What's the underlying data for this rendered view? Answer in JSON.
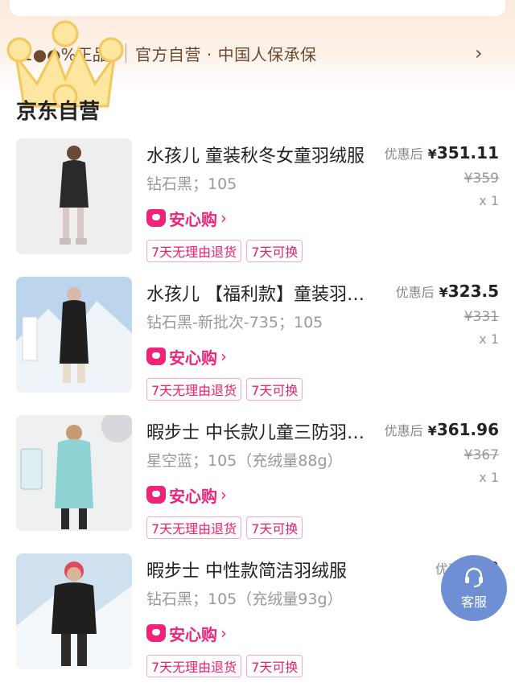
{
  "banner": {
    "badge": "1●●%正品",
    "text": "官方自营 · 中国人保承保",
    "arrow": "›"
  },
  "section_title": "京东自营",
  "products": [
    {
      "title": "水孩儿 童装秋冬女童羽绒服",
      "spec": "钻石黑；105",
      "anxin": "安心购",
      "tags": [
        "7天无理由退货",
        "7天可换"
      ],
      "price_label": "优惠后",
      "price_yen": "¥",
      "price": "351.11",
      "orig_price": "¥359",
      "qty": "x 1"
    },
    {
      "title": "水孩儿 【福利款】童装羽绒服",
      "spec": "钻石黑-新批次-735；105",
      "anxin": "安心购",
      "tags": [
        "7天无理由退货",
        "7天可换"
      ],
      "price_label": "优惠后",
      "price_yen": "¥",
      "price": "323.5",
      "orig_price": "¥331",
      "qty": "x 1"
    },
    {
      "title": "暇步士 中长款儿童三防羽绒服",
      "spec": "星空蓝；105（充绒量88g）",
      "anxin": "安心购",
      "tags": [
        "7天无理由退货",
        "7天可换"
      ],
      "price_label": "优惠后",
      "price_yen": "¥",
      "price": "361.96",
      "orig_price": "¥367",
      "qty": "x 1"
    },
    {
      "title": "暇步士 中性款简洁羽绒服",
      "spec": "钻石黑；105（充绒量93g）",
      "anxin": "安心购",
      "tags": [
        "7天无理由退货",
        "7天可换"
      ],
      "price_label": "优惠后",
      "price_yen": "¥",
      "price": "2",
      "orig_price": "",
      "qty": ""
    }
  ],
  "service": {
    "label": "客服",
    "icon": "headset-icon"
  },
  "colors": {
    "accent_pink": "#f0237a",
    "service_blue": "#6f8fd4",
    "banner_text": "#6a4a30"
  }
}
